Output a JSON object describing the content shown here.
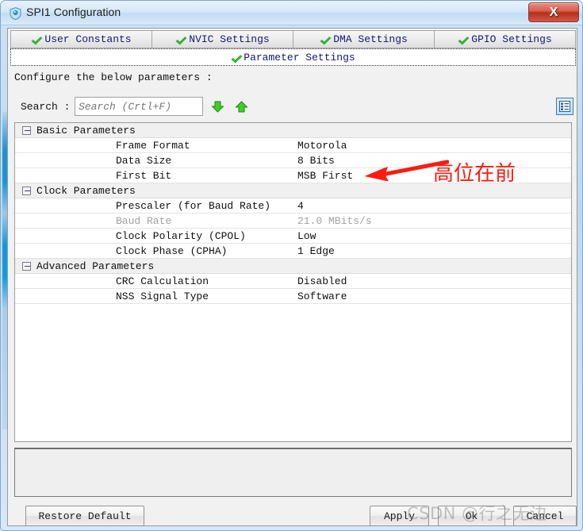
{
  "window": {
    "title": "SPI1 Configuration",
    "icon": "shield-icon",
    "close_label": "X"
  },
  "tabs": [
    {
      "label": "User Constants",
      "icon": "green-check-icon",
      "active": false
    },
    {
      "label": "NVIC Settings",
      "icon": "green-check-icon",
      "active": false
    },
    {
      "label": "DMA Settings",
      "icon": "green-check-icon",
      "active": false
    },
    {
      "label": "GPIO Settings",
      "icon": "green-check-icon",
      "active": false
    }
  ],
  "active_tab": {
    "label": "Parameter Settings",
    "icon": "green-check-icon"
  },
  "header": {
    "instruction": "Configure the below parameters :"
  },
  "search": {
    "label": "Search :",
    "placeholder": "Search (Crtl+F)",
    "value": "",
    "next_icon": "arrow-down-icon",
    "prev_icon": "arrow-up-icon",
    "view_icon": "list-view-icon"
  },
  "groups": [
    {
      "name": "Basic Parameters",
      "expanded": true,
      "rows": [
        {
          "name": "Frame Format",
          "value": "Motorola",
          "disabled": false
        },
        {
          "name": "Data Size",
          "value": "8 Bits",
          "disabled": false
        },
        {
          "name": "First Bit",
          "value": "MSB First",
          "disabled": false
        }
      ]
    },
    {
      "name": "Clock Parameters",
      "expanded": true,
      "rows": [
        {
          "name": "Prescaler (for Baud Rate)",
          "value": "4",
          "disabled": false
        },
        {
          "name": "Baud Rate",
          "value": "21.0 MBits/s",
          "disabled": true
        },
        {
          "name": "Clock Polarity (CPOL)",
          "value": "Low",
          "disabled": false
        },
        {
          "name": "Clock Phase (CPHA)",
          "value": "1 Edge",
          "disabled": false
        }
      ]
    },
    {
      "name": "Advanced Parameters",
      "expanded": true,
      "rows": [
        {
          "name": "CRC Calculation",
          "value": "Disabled",
          "disabled": false
        },
        {
          "name": "NSS Signal Type",
          "value": "Software",
          "disabled": false
        }
      ]
    }
  ],
  "buttons": {
    "restore": "Restore Default",
    "apply": "Apply",
    "ok": "Ok",
    "cancel": "Cancel"
  },
  "annotation": {
    "text": "高位在前",
    "color": "#fc1c10",
    "arrow": "red-left-arrow-icon"
  },
  "watermark": {
    "text": "CSDN @行之无边"
  }
}
